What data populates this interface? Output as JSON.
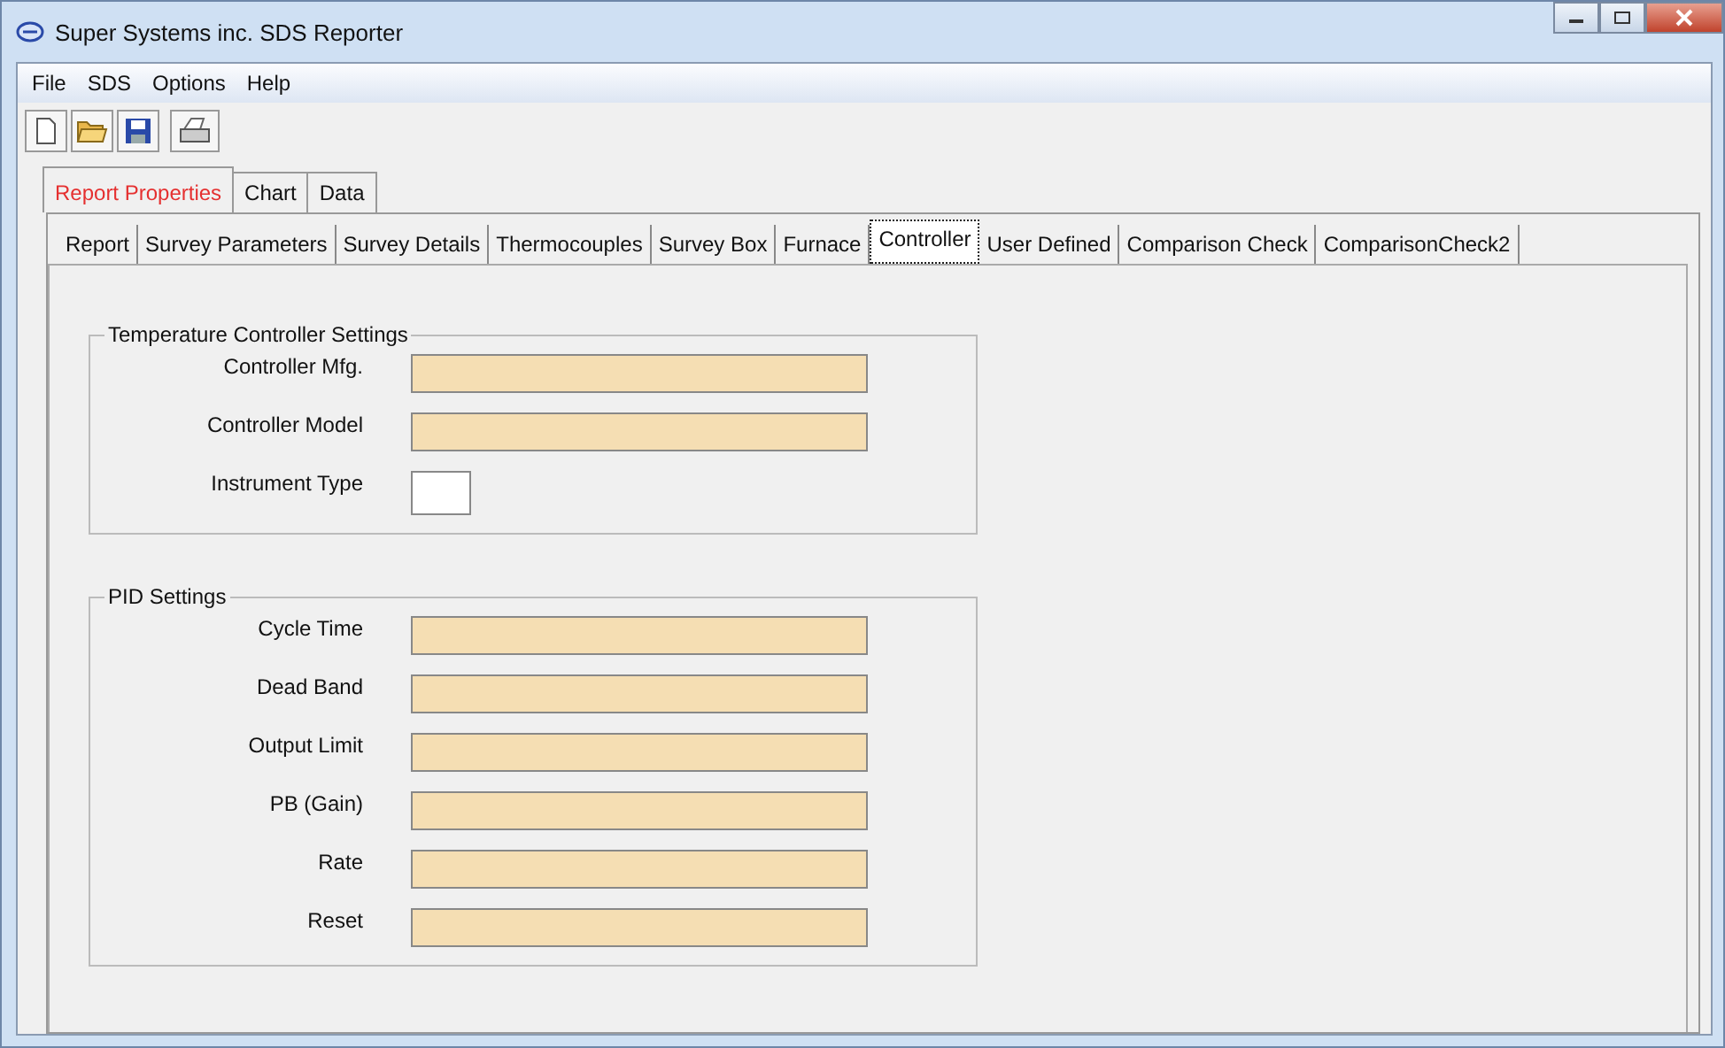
{
  "window": {
    "title": "Super Systems inc. SDS Reporter"
  },
  "menu": [
    "File",
    "SDS",
    "Options",
    "Help"
  ],
  "toolbar": [
    {
      "kind": "new"
    },
    {
      "kind": "open"
    },
    {
      "kind": "save"
    },
    {
      "kind": "print"
    }
  ],
  "tabs": [
    {
      "label": "Report Properties",
      "selected": true
    },
    {
      "label": "Chart",
      "selected": false
    },
    {
      "label": "Data",
      "selected": false
    }
  ],
  "subtabs": [
    {
      "label": "Report",
      "selected": false
    },
    {
      "label": "Survey Parameters",
      "selected": false
    },
    {
      "label": "Survey Details",
      "selected": false
    },
    {
      "label": "Thermocouples",
      "selected": false
    },
    {
      "label": "Survey Box",
      "selected": false
    },
    {
      "label": "Furnace",
      "selected": false
    },
    {
      "label": "Controller",
      "selected": true
    },
    {
      "label": "User Defined",
      "selected": false
    },
    {
      "label": "Comparison Check",
      "selected": false
    },
    {
      "label": "ComparisonCheck2",
      "selected": false
    }
  ],
  "groups": [
    {
      "title": "Temperature Controller Settings",
      "fields": [
        {
          "label": "Controller Mfg.",
          "kind": "text"
        },
        {
          "label": "Controller Model",
          "kind": "text"
        },
        {
          "label": "Instrument Type",
          "kind": "box"
        }
      ]
    },
    {
      "title": "PID Settings",
      "fields": [
        {
          "label": "Cycle Time",
          "kind": "text"
        },
        {
          "label": "Dead Band",
          "kind": "text"
        },
        {
          "label": "Output Limit",
          "kind": "text"
        },
        {
          "label": "PB (Gain)",
          "kind": "text"
        },
        {
          "label": "Rate",
          "kind": "text"
        },
        {
          "label": "Reset",
          "kind": "text"
        }
      ]
    }
  ]
}
